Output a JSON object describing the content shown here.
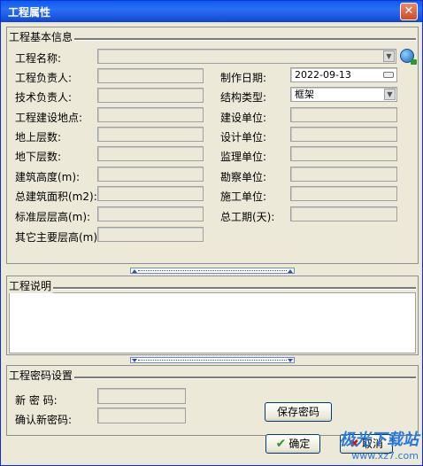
{
  "window": {
    "title": "工程属性",
    "close_glyph": "✕"
  },
  "basic_info": {
    "section_title": "工程基本信息",
    "fields": {
      "project_name": {
        "label": "工程名称:",
        "value": ""
      },
      "project_manager": {
        "label": "工程负责人:",
        "value": ""
      },
      "tech_manager": {
        "label": "技术负责人:",
        "value": ""
      },
      "location": {
        "label": "工程建设地点:",
        "value": ""
      },
      "floors_above": {
        "label": "地上层数:",
        "value": ""
      },
      "floors_below": {
        "label": "地下层数:",
        "value": ""
      },
      "building_height": {
        "label": "建筑高度(m):",
        "value": ""
      },
      "total_area": {
        "label": "总建筑面积(m2):",
        "value": ""
      },
      "std_floor_height": {
        "label": "标准层层高(m):",
        "value": ""
      },
      "other_floor_height": {
        "label": "其它主要层高(m):",
        "value": ""
      },
      "created_date": {
        "label": "制作日期:",
        "value": "2022-09-13"
      },
      "structure_type": {
        "label": "结构类型:",
        "value": "框架"
      },
      "builder_unit": {
        "label": "建设单位:",
        "value": ""
      },
      "design_unit": {
        "label": "设计单位:",
        "value": ""
      },
      "supervisor_unit": {
        "label": "监理单位:",
        "value": ""
      },
      "survey_unit": {
        "label": "勘察单位:",
        "value": ""
      },
      "construction_unit": {
        "label": "施工单位:",
        "value": ""
      },
      "total_duration": {
        "label": "总工期(天):",
        "value": ""
      }
    }
  },
  "description": {
    "section_title": "工程说明",
    "text": ""
  },
  "password": {
    "section_title": "工程密码设置",
    "new_password_label": "新 密 码:",
    "confirm_password_label": "确认新密码:",
    "save_button": "保存密码"
  },
  "footer": {
    "ok_button": "确定",
    "cancel_button": "取消"
  },
  "watermark": {
    "brand": "极光下载站",
    "url": "www.xz7.com"
  },
  "colors": {
    "title_bar": "#0a5cf0",
    "window_bg": "#ece9d8",
    "splitter": "#6a8ac8"
  },
  "icons": {
    "globe": "globe-icon",
    "ok": "check-icon",
    "cancel": "x-icon",
    "dropdown": "chevron-down-icon"
  }
}
